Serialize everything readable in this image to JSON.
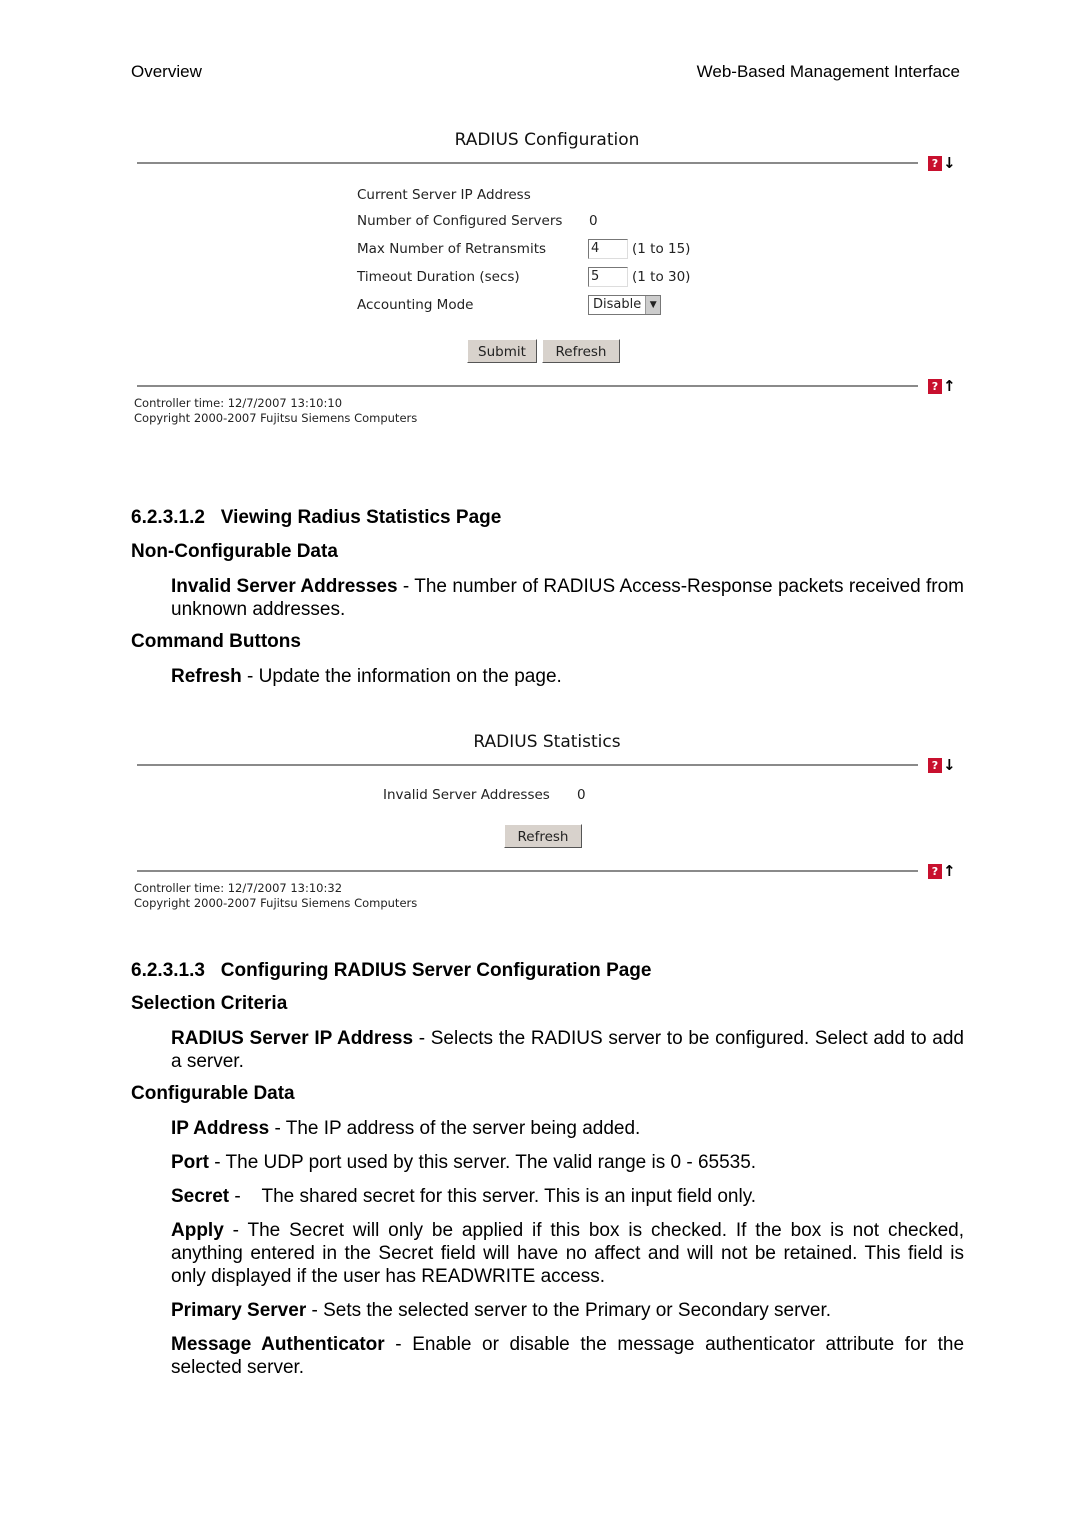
{
  "header": {
    "left": "Overview",
    "right": "Web-Based Management Interface"
  },
  "radius_config": {
    "title": "RADIUS Configuration",
    "rows": [
      {
        "label": "Current Server IP Address",
        "value": ""
      },
      {
        "label": "Number of Configured Servers",
        "value": "0"
      },
      {
        "label": "Max Number of Retransmits",
        "input": "4",
        "range": "(1 to 15)"
      },
      {
        "label": "Timeout Duration (secs)",
        "input": "5",
        "range": "(1 to 30)"
      },
      {
        "label": "Accounting Mode",
        "select": "Disable"
      }
    ],
    "submit": "Submit",
    "refresh": "Refresh",
    "controller_time": "Controller time: 12/7/2007 13:10:10",
    "copyright": "Copyright 2000-2007 Fujitsu Siemens Computers"
  },
  "icons": {
    "help": "?",
    "down": "↓",
    "up": "↑",
    "help_color": "#c8102e"
  },
  "sec1": {
    "heading": "6.2.3.1.2   Viewing Radius Statistics Page",
    "sub1": "Non-Configurable Data",
    "p1_term": "Invalid Server Addresses",
    "p1_text": " - The number of RADIUS Access-Response packets received from unknown addresses.",
    "sub2": "Command Buttons",
    "p2_term": "Refresh",
    "p2_text": " - Update the information on the page."
  },
  "radius_stats": {
    "title": "RADIUS Statistics",
    "label": "Invalid Server Addresses",
    "value": "0",
    "refresh": "Refresh",
    "controller_time": "Controller time: 12/7/2007 13:10:32",
    "copyright": "Copyright 2000-2007 Fujitsu Siemens Computers"
  },
  "sec2": {
    "heading": "6.2.3.1.3   Configuring RADIUS Server Configuration Page",
    "sub1": "Selection Criteria",
    "p1_term": "RADIUS Server IP Address",
    "p1_text": " - Selects the RADIUS server to be configured. Select add to add a server.",
    "sub2": "Configurable Data",
    "items": [
      {
        "term": "IP Address",
        "text": " - The IP address of the server being added."
      },
      {
        "term": "Port",
        "text": " - The UDP port used by this server. The valid range is 0 - 65535."
      },
      {
        "term": "Secret",
        "text": " -    The shared secret for this server. This is an input field only."
      },
      {
        "term": "Apply",
        "text": " - The Secret will only be applied if this box is checked. If the box is not checked, anything entered in the Secret field will have no affect and will not be retained. This field is only displayed if the user has READWRITE access."
      },
      {
        "term": "Primary Server",
        "text": " - Sets the selected server to the Primary or Secondary server."
      },
      {
        "term": "Message Authenticator",
        "text": " - Enable or disable the message authenticator attribute for the selected server."
      }
    ]
  }
}
